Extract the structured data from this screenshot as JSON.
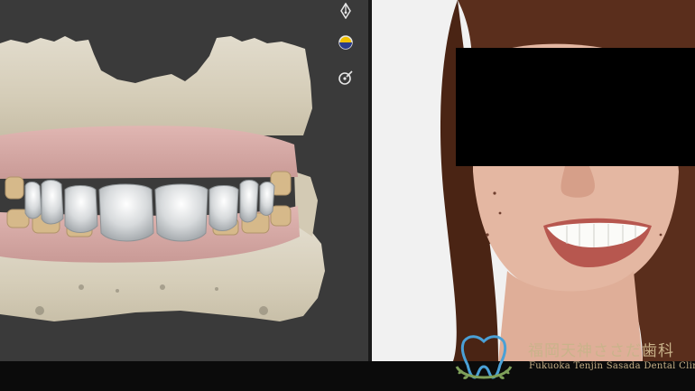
{
  "toolbar": {
    "tools": [
      {
        "icon": "pen-tip-icon",
        "state": "normal"
      },
      {
        "icon": "shading-toggle-icon",
        "state": "active",
        "color": "#f2c200"
      },
      {
        "icon": "measure-target-icon",
        "state": "normal"
      }
    ]
  },
  "clinic": {
    "name_jp": "福岡天神ささだ歯科",
    "name_en": "Fukuoka Tenjin Sasada Dental Clinic",
    "accent_color": "#c9b38a",
    "logo_colors": [
      "#4aa0d6",
      "#7fa05a"
    ]
  }
}
